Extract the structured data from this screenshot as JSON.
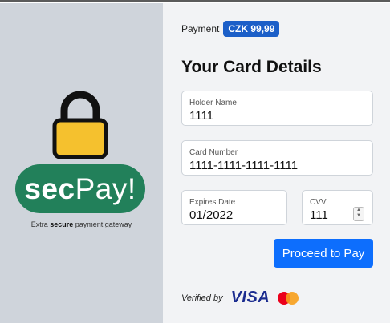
{
  "brand": {
    "name_bold": "sec",
    "name_rest": "Pay!",
    "tagline_pre": "Extra ",
    "tagline_bold": "secure",
    "tagline_post": " payment gateway",
    "color": "#22805a"
  },
  "payment": {
    "label": "Payment",
    "amount": "CZK 99,99"
  },
  "heading": "Your Card Details",
  "fields": {
    "holder": {
      "label": "Holder Name",
      "value": "1111"
    },
    "card": {
      "label": "Card Number",
      "value": "1111-1111-1111-1111"
    },
    "expires": {
      "label": "Expires Date",
      "value": "01/2022"
    },
    "cvv": {
      "label": "CVV",
      "value": "111"
    }
  },
  "proceed_label": "Proceed to Pay",
  "verified": {
    "label": "Verified by",
    "visa": "VISA",
    "icons": [
      "visa-logo",
      "mastercard-logo"
    ]
  },
  "colors": {
    "left_panel": "#cfd4db",
    "right_panel": "#f2f3f5",
    "button": "#0d6efd",
    "badge": "#1c5fc8"
  }
}
